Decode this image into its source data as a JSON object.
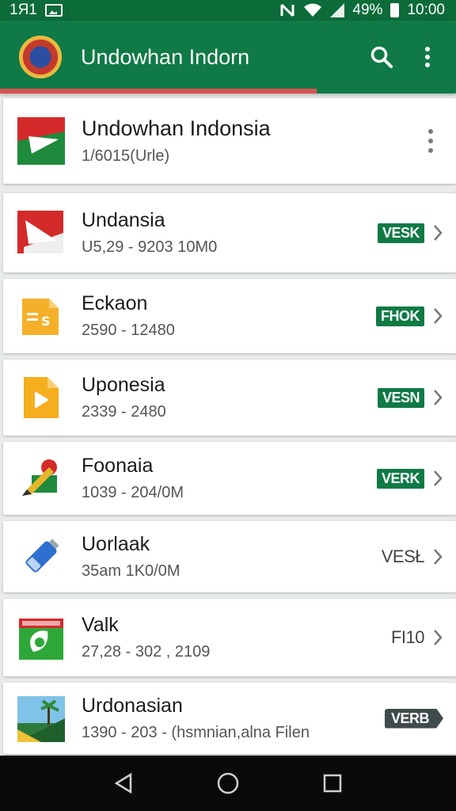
{
  "status_bar": {
    "left_text": "1Я1",
    "battery": "49%",
    "time": "10:00"
  },
  "app_bar": {
    "title": "Undowhan Indorn",
    "search_icon": "search-icon",
    "menu_icon": "more-vert-icon"
  },
  "list": {
    "items": [
      {
        "title": "Undowhan Indonsia",
        "subtitle": "1/6015(Urle)",
        "badge": "",
        "icon": "flag-icon"
      },
      {
        "title": "Undansia",
        "subtitle": "U5,29 - 9203 10M0",
        "badge": "VESK",
        "icon": "flag-paper-icon"
      },
      {
        "title": "Eckaon",
        "subtitle": "2590 - 12480",
        "badge": "FHOK",
        "icon": "slides-icon"
      },
      {
        "title": "Uponesia",
        "subtitle": "2339 - 2480",
        "badge": "VESN",
        "icon": "play-file-icon"
      },
      {
        "title": "Foonaia",
        "subtitle": "1039 - 204/0M",
        "badge": "VERK",
        "icon": "pencil-flag-icon"
      },
      {
        "title": "Uorlaak",
        "subtitle": "35am 1K0/0M",
        "badge": "VESŁ",
        "icon": "usb-drive-icon"
      },
      {
        "title": "Valk",
        "subtitle": "27,28 - 302 , 2109",
        "badge": "FI10",
        "icon": "leaf-card-icon"
      },
      {
        "title": "Urdonasian",
        "subtitle": "1390 - 203 - (hsmnian,alna Filen",
        "badge": "VERB",
        "icon": "landscape-icon"
      }
    ]
  },
  "nav_bar": {
    "back_icon": "back-triangle-icon",
    "home_icon": "home-circle-icon",
    "recents_icon": "recents-square-icon"
  },
  "colors": {
    "primary": "#0f7a45",
    "status": "#0b6b39",
    "accent": "#d9534f"
  }
}
